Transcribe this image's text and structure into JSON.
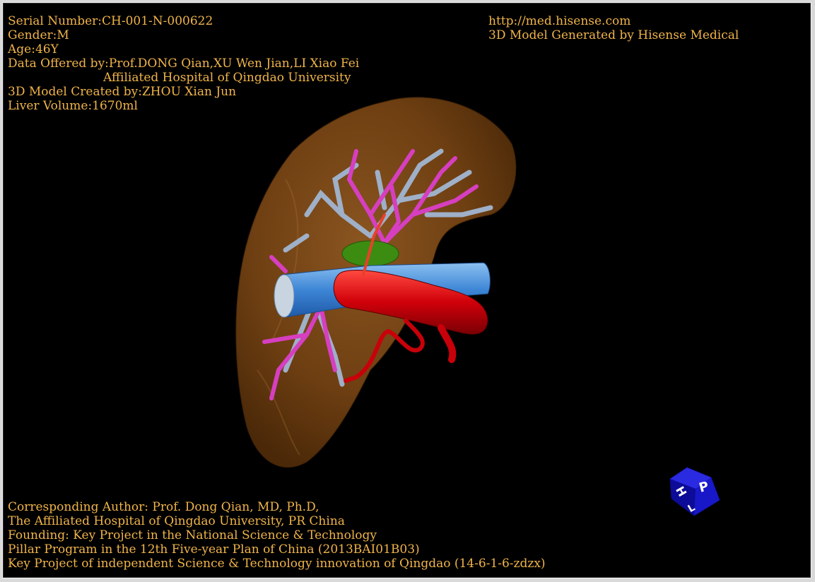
{
  "header_left": {
    "serial": "Serial Number:CH-001-N-000622",
    "gender": "Gender:M",
    "age": "Age:46Y",
    "data_offered": "Data Offered by:Prof.DONG Qian,XU Wen Jian,LI Xiao Fei",
    "hospital": "Affiliated Hospital of Qingdao University",
    "created_by": "3D Model Created by:ZHOU Xian Jun",
    "volume": "Liver Volume:1670ml"
  },
  "header_right": {
    "url": "http://med.hisense.com",
    "generator": "3D Model Generated by Hisense Medical"
  },
  "footer": {
    "line1": "Corresponding Author: Prof. Dong Qian, MD, Ph.D,",
    "line2": "The Affiliated Hospital of Qingdao University, PR China",
    "line3": "Founding: Key Project in the National Science & Technology",
    "line4": "Pillar Program in the 12th Five-year Plan of China (2013BAI01B03)",
    "line5": "Key Project of independent Science & Technology innovation of Qingdao (14-6-1-6-zdzx)"
  },
  "orientation_cube": {
    "face_front": "P",
    "face_side": "H",
    "face_top": "L"
  },
  "colors": {
    "text": "#f0b44a",
    "background": "#000000",
    "liver": "#7a4714",
    "artery": "#d4000a",
    "portal_vein": "#4a90d9",
    "hepatic_vein": "#d63fc0",
    "bile": "#9aa8c0",
    "gallbladder": "#3a8a10",
    "cube": "#1414c8"
  }
}
